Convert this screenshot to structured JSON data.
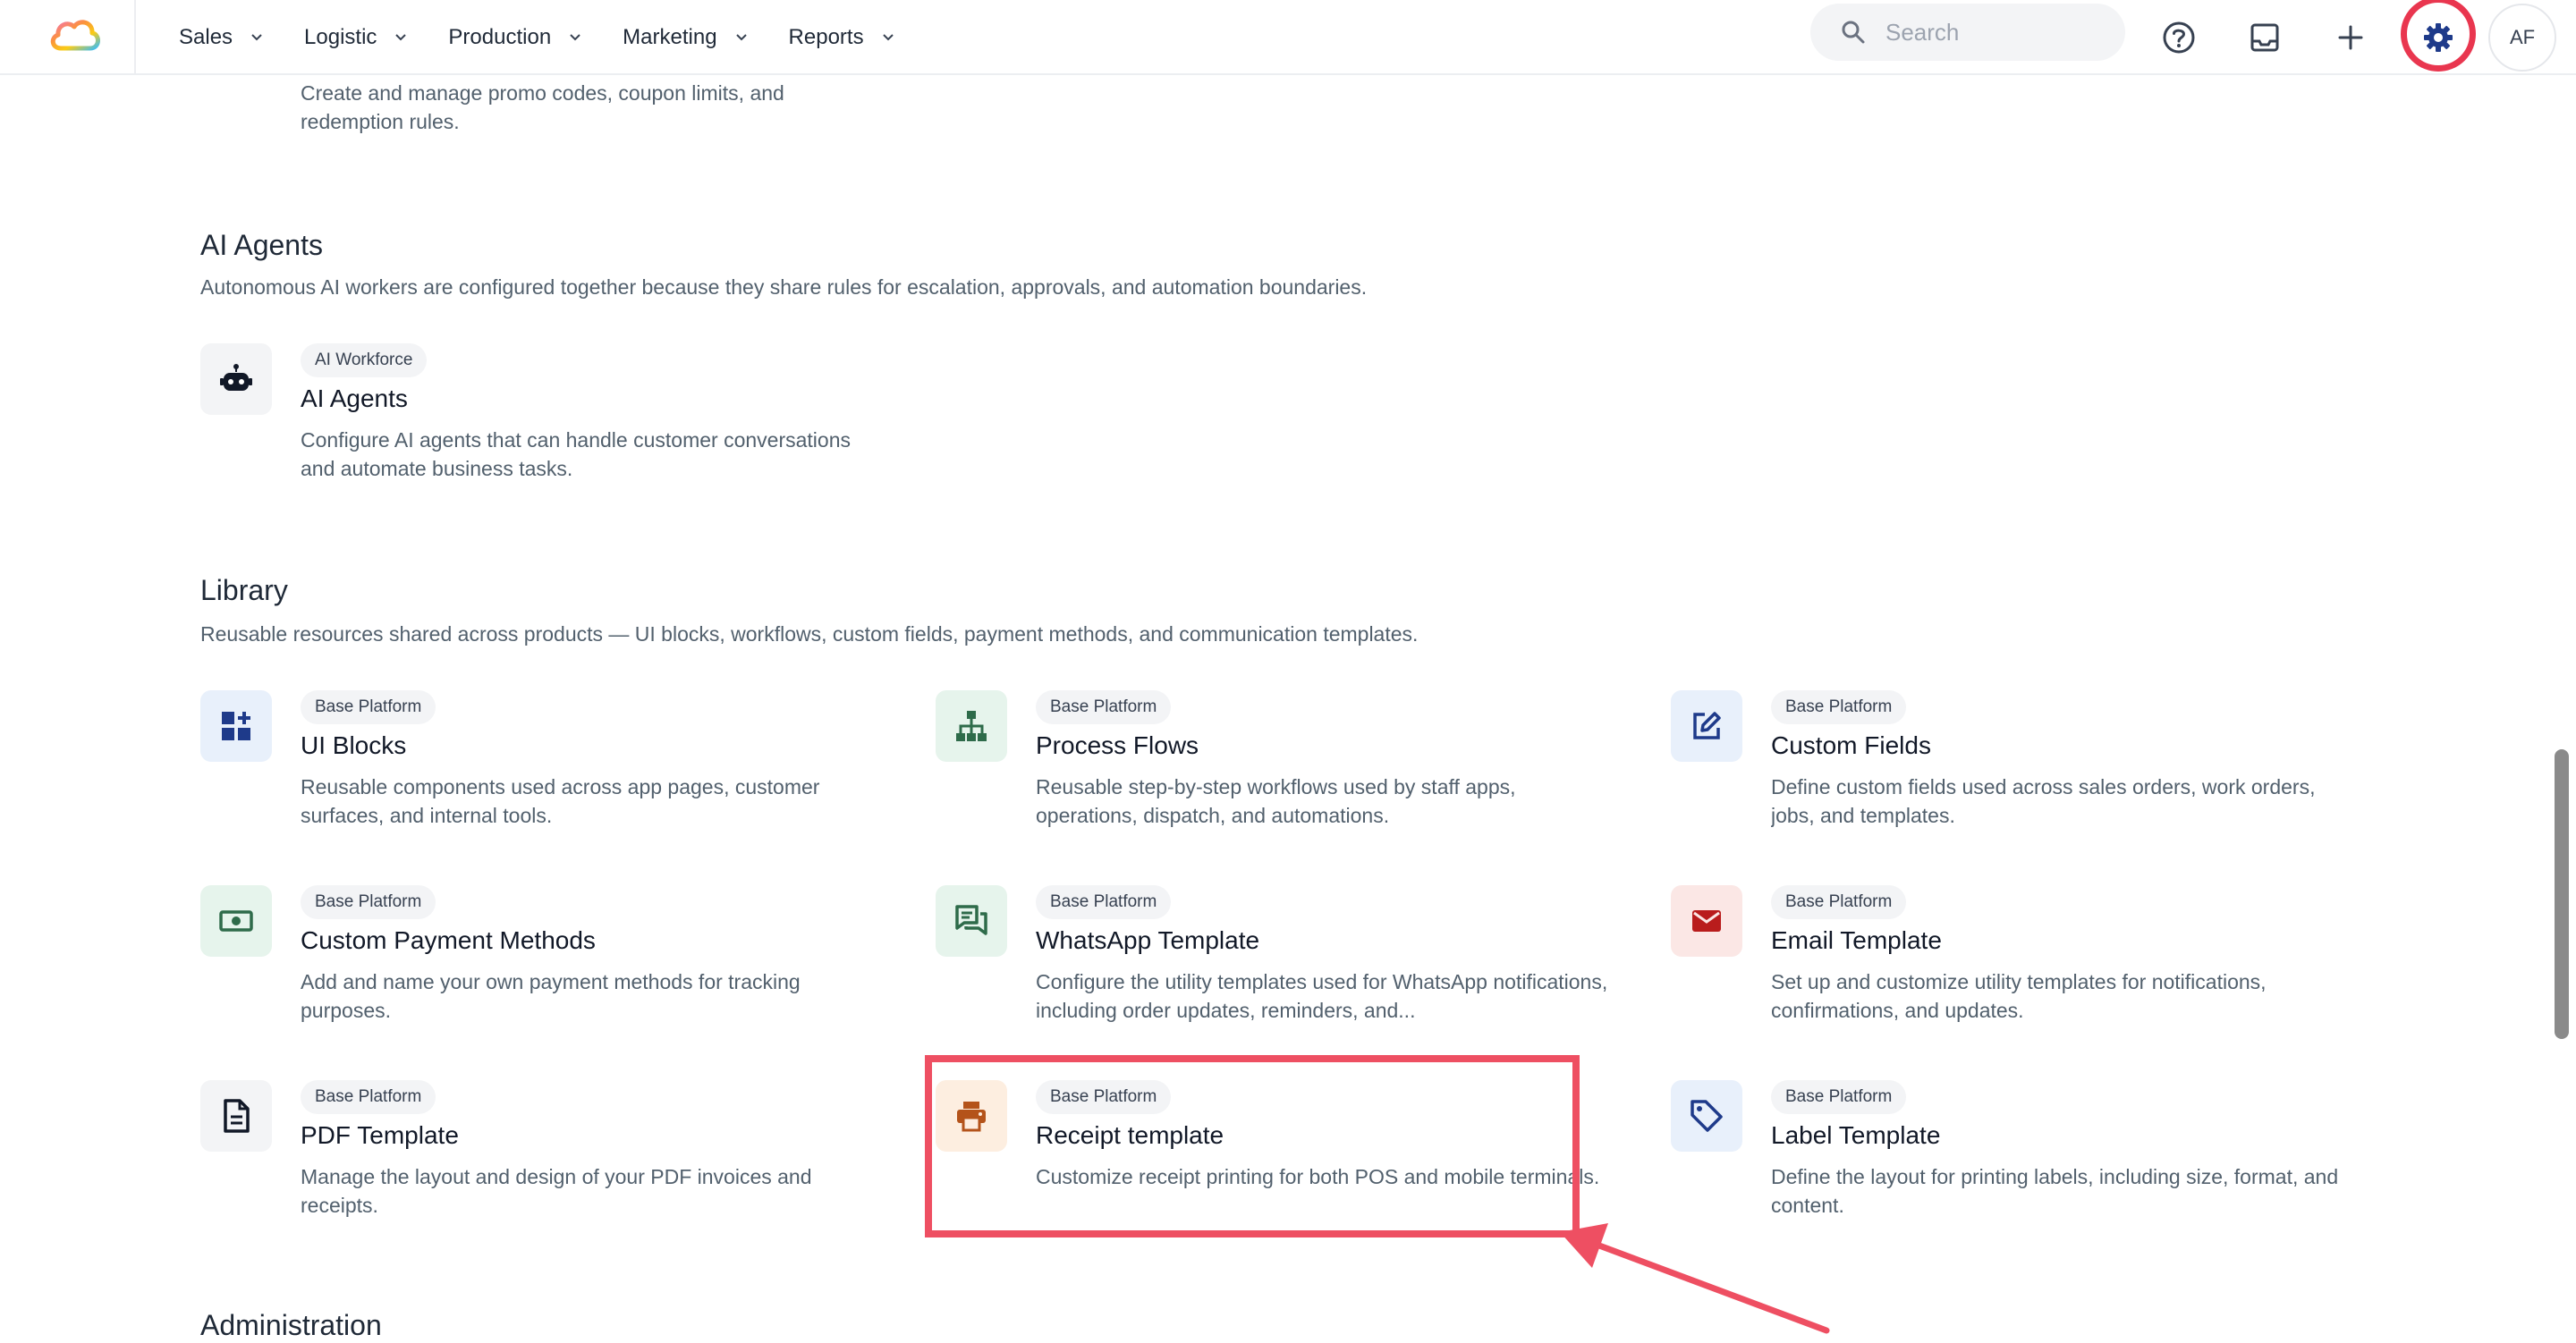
{
  "topbar": {
    "nav": [
      {
        "label": "Sales"
      },
      {
        "label": "Logistic"
      },
      {
        "label": "Production"
      },
      {
        "label": "Marketing"
      },
      {
        "label": "Reports"
      }
    ],
    "search_placeholder": "Search",
    "avatar_initials": "AF"
  },
  "colors": {
    "highlight": "#ee4f62",
    "gear": "#1e3a8a"
  },
  "promo": {
    "desc": "Create and manage promo codes, coupon limits, and redemption rules."
  },
  "ai_agents": {
    "title": "AI Agents",
    "desc": "Autonomous AI workers are configured together because they share rules for escalation, approvals, and automation boundaries.",
    "items": [
      {
        "badge": "AI Workforce",
        "title": "AI Agents",
        "desc": "Configure AI agents that can handle customer conversations and automate business tasks.",
        "icon": "robot-icon"
      }
    ]
  },
  "library": {
    "title": "Library",
    "desc": "Reusable resources shared across products — UI blocks, workflows, custom fields, payment methods, and communication templates.",
    "items": [
      {
        "badge": "Base Platform",
        "title": "UI Blocks",
        "desc": "Reusable components used across app pages, customer surfaces, and internal tools.",
        "icon": "widgets-icon"
      },
      {
        "badge": "Base Platform",
        "title": "Process Flows",
        "desc": "Reusable step-by-step workflows used by staff apps, operations, dispatch, and automations.",
        "icon": "hierarchy-icon"
      },
      {
        "badge": "Base Platform",
        "title": "Custom Fields",
        "desc": "Define custom fields used across sales orders, work orders, jobs, and templates.",
        "icon": "edit-icon"
      },
      {
        "badge": "Base Platform",
        "title": "Custom Payment Methods",
        "desc": "Add and name your own payment methods for tracking purposes.",
        "icon": "money-icon"
      },
      {
        "badge": "Base Platform",
        "title": "WhatsApp Template",
        "desc": "Configure the utility templates used for WhatsApp notifications, including order updates, reminders, and...",
        "icon": "chat-icon"
      },
      {
        "badge": "Base Platform",
        "title": "Email Template",
        "desc": "Set up and customize utility templates for notifications, confirmations, and updates.",
        "icon": "mail-icon"
      },
      {
        "badge": "Base Platform",
        "title": "PDF Template",
        "desc": "Manage the layout and design of your PDF invoices and receipts.",
        "icon": "document-icon"
      },
      {
        "badge": "Base Platform",
        "title": "Receipt template",
        "desc": "Customize receipt printing for both POS and mobile terminals.",
        "icon": "printer-icon"
      },
      {
        "badge": "Base Platform",
        "title": "Label Template",
        "desc": "Define the layout for printing labels, including size, format, and content.",
        "icon": "tag-icon"
      }
    ]
  },
  "administration": {
    "title": "Administration"
  }
}
